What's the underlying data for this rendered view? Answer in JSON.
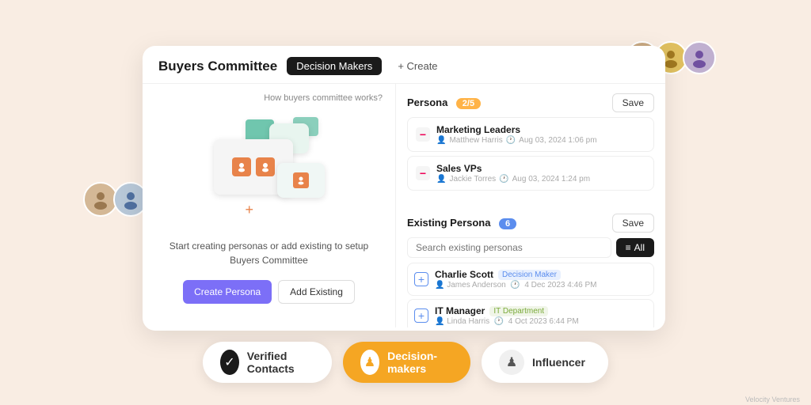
{
  "page": {
    "background": "#f9ede3",
    "title": "Buyers Committee"
  },
  "header": {
    "title": "Buyers Committee",
    "tab_active": "Decision Makers",
    "tab_create": "+ Create"
  },
  "left_panel": {
    "how_link": "How buyers committee works?",
    "description": "Start creating personas or add existing to setup Buyers Committee",
    "btn_create": "Create Persona",
    "btn_add": "Add Existing"
  },
  "persona_section": {
    "title": "Persona",
    "badge": "2/5",
    "save_label": "Save",
    "items": [
      {
        "name": "Marketing Leaders",
        "user": "Matthew Harris",
        "date": "Aug 03, 2024 1:06 pm"
      },
      {
        "name": "Sales VPs",
        "user": "Jackie Torres",
        "date": "Aug 03, 2024 1:24 pm"
      }
    ]
  },
  "existing_section": {
    "title": "Existing Persona",
    "badge": "6",
    "save_label": "Save",
    "search_placeholder": "Search existing personas",
    "filter_label": "All",
    "items": [
      {
        "name": "Charlie Scott",
        "tag": "Decision Maker",
        "tag_type": "decision",
        "sub": "James Anderson",
        "date": "4 Dec 2023 4:46 PM"
      },
      {
        "name": "IT Manager",
        "tag": "IT Department",
        "tag_type": "dept",
        "sub": "Linda Harris",
        "date": "4 Oct 2023 6:44 PM"
      }
    ]
  },
  "bottom_bar": {
    "pills": [
      {
        "id": "verified",
        "icon": "✓",
        "icon_style": "check",
        "label": "Verified Contacts",
        "active": false
      },
      {
        "id": "decision",
        "icon": "♟",
        "icon_style": "chess",
        "label": "Decision-makers",
        "active": true
      },
      {
        "id": "influencer",
        "icon": "♟",
        "icon_style": "inf",
        "label": "Influencer",
        "active": false
      }
    ]
  },
  "velocity": "Velocity Ventures"
}
